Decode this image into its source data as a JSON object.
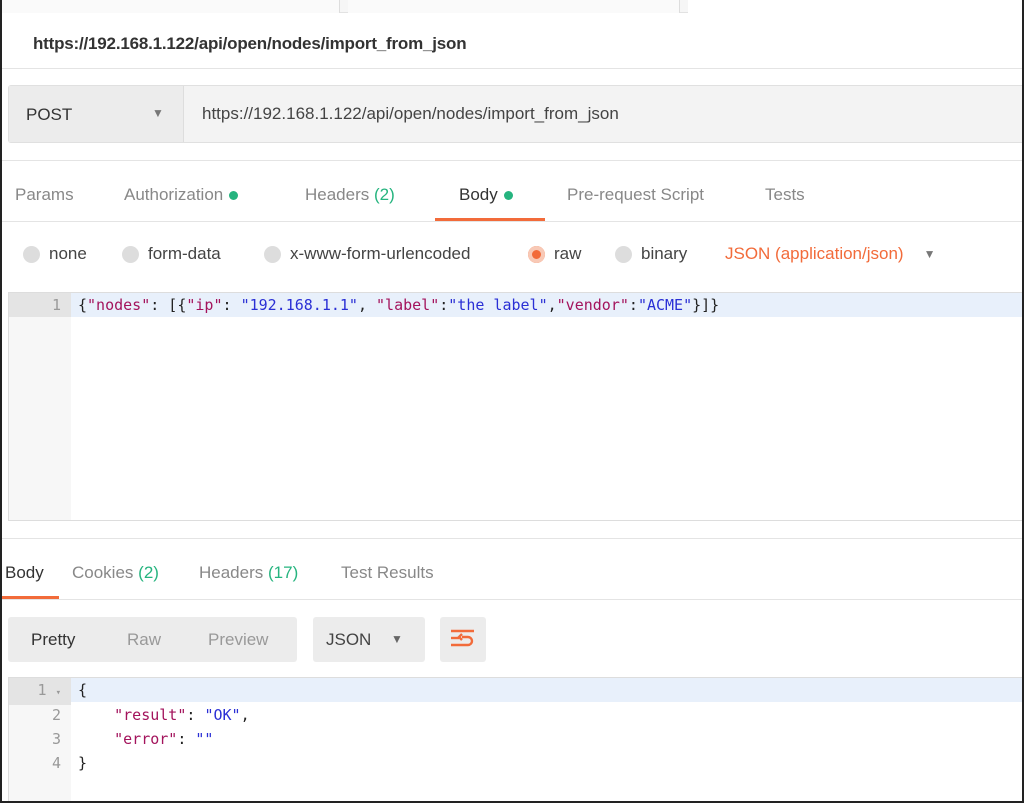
{
  "title": "https://192.168.1.122/api/open/nodes/import_from_json",
  "request": {
    "method": "POST",
    "url": "https://192.168.1.122/api/open/nodes/import_from_json",
    "tabs": [
      {
        "label": "Params"
      },
      {
        "label": "Authorization"
      },
      {
        "label": "Headers",
        "count": "(2)"
      },
      {
        "label": "Body"
      },
      {
        "label": "Pre-request Script"
      },
      {
        "label": "Tests"
      }
    ],
    "active_tab": "Body",
    "body_modes": [
      "none",
      "form-data",
      "x-www-form-urlencoded",
      "raw",
      "binary"
    ],
    "selected_mode": "raw",
    "content_type": "JSON (application/json)",
    "body_lines": [
      {
        "n": "1",
        "text": "{\"nodes\": [{\"ip\": \"192.168.1.1\", \"label\":\"the label\",\"vendor\":\"ACME\"}]}"
      }
    ]
  },
  "response": {
    "tabs": [
      {
        "label": "Body"
      },
      {
        "label": "Cookies",
        "count": "(2)"
      },
      {
        "label": "Headers",
        "count": "(17)"
      },
      {
        "label": "Test Results"
      }
    ],
    "view_modes": [
      "Pretty",
      "Raw",
      "Preview"
    ],
    "format": "JSON",
    "lines": [
      {
        "n": "1",
        "text": "{"
      },
      {
        "n": "2",
        "text": "    \"result\": \"OK\","
      },
      {
        "n": "3",
        "text": "    \"error\": \"\""
      },
      {
        "n": "4",
        "text": "}"
      }
    ]
  },
  "colors": {
    "accent": "#f26b3a",
    "green": "#26b47f"
  },
  "icons": [
    "chevron-down-icon",
    "wrap-lines-icon"
  ]
}
